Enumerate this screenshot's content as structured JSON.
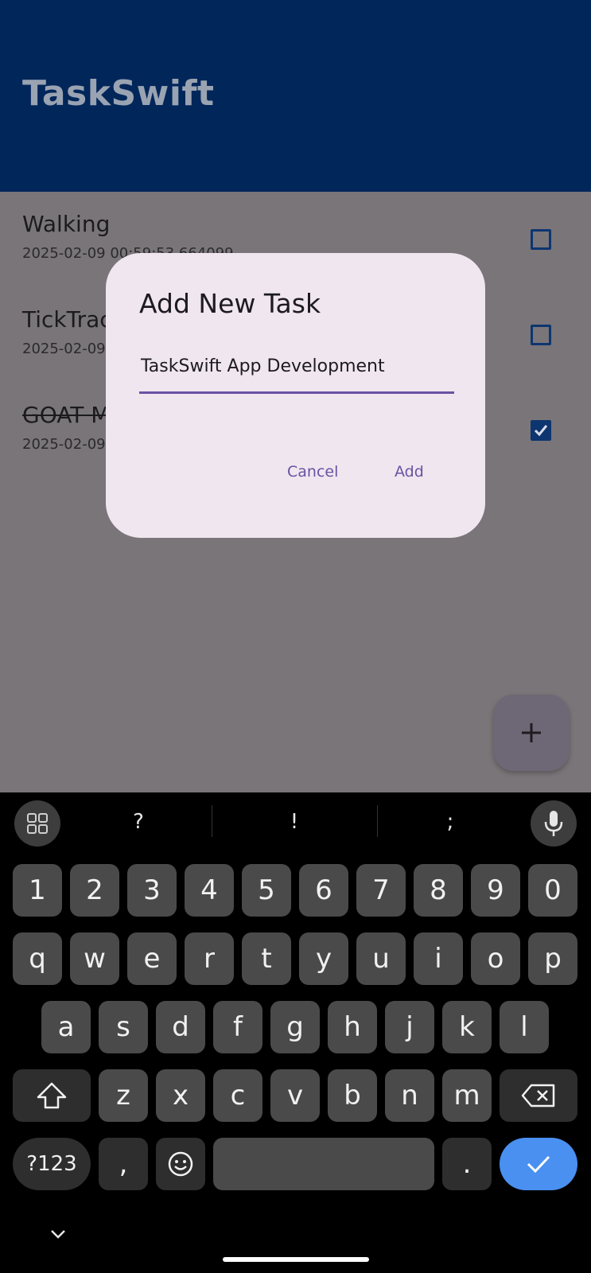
{
  "app": {
    "title": "TaskSwift"
  },
  "tasks": [
    {
      "title": "Walking",
      "date": "2025-02-09 00:59:53.664099",
      "done": false
    },
    {
      "title": "TickTrack",
      "date": "2025-02-09",
      "done": false
    },
    {
      "title": "GOAT M",
      "date": "2025-02-09",
      "done": true
    }
  ],
  "dialog": {
    "title": "Add New Task",
    "input_value": "TaskSwift App Development",
    "cancel_label": "Cancel",
    "add_label": "Add"
  },
  "fab": {
    "icon": "plus-icon"
  },
  "keyboard": {
    "suggestions": [
      "?",
      "!",
      ";"
    ],
    "row_numbers": [
      "1",
      "2",
      "3",
      "4",
      "5",
      "6",
      "7",
      "8",
      "9",
      "0"
    ],
    "row_top": [
      "q",
      "w",
      "e",
      "r",
      "t",
      "y",
      "u",
      "i",
      "o",
      "p"
    ],
    "row_middle": [
      "a",
      "s",
      "d",
      "f",
      "g",
      "h",
      "j",
      "k",
      "l"
    ],
    "row_bottom": [
      "z",
      "x",
      "c",
      "v",
      "b",
      "n",
      "m"
    ],
    "symbols_label": "?123",
    "comma": ",",
    "period": "."
  },
  "colors": {
    "appbar": "#01265A",
    "scrim": "#7a7578",
    "dialog": "#f0e6ef",
    "accent": "#6a52a3",
    "checkbox": "#0d3570",
    "enter_key": "#4a90f0"
  }
}
